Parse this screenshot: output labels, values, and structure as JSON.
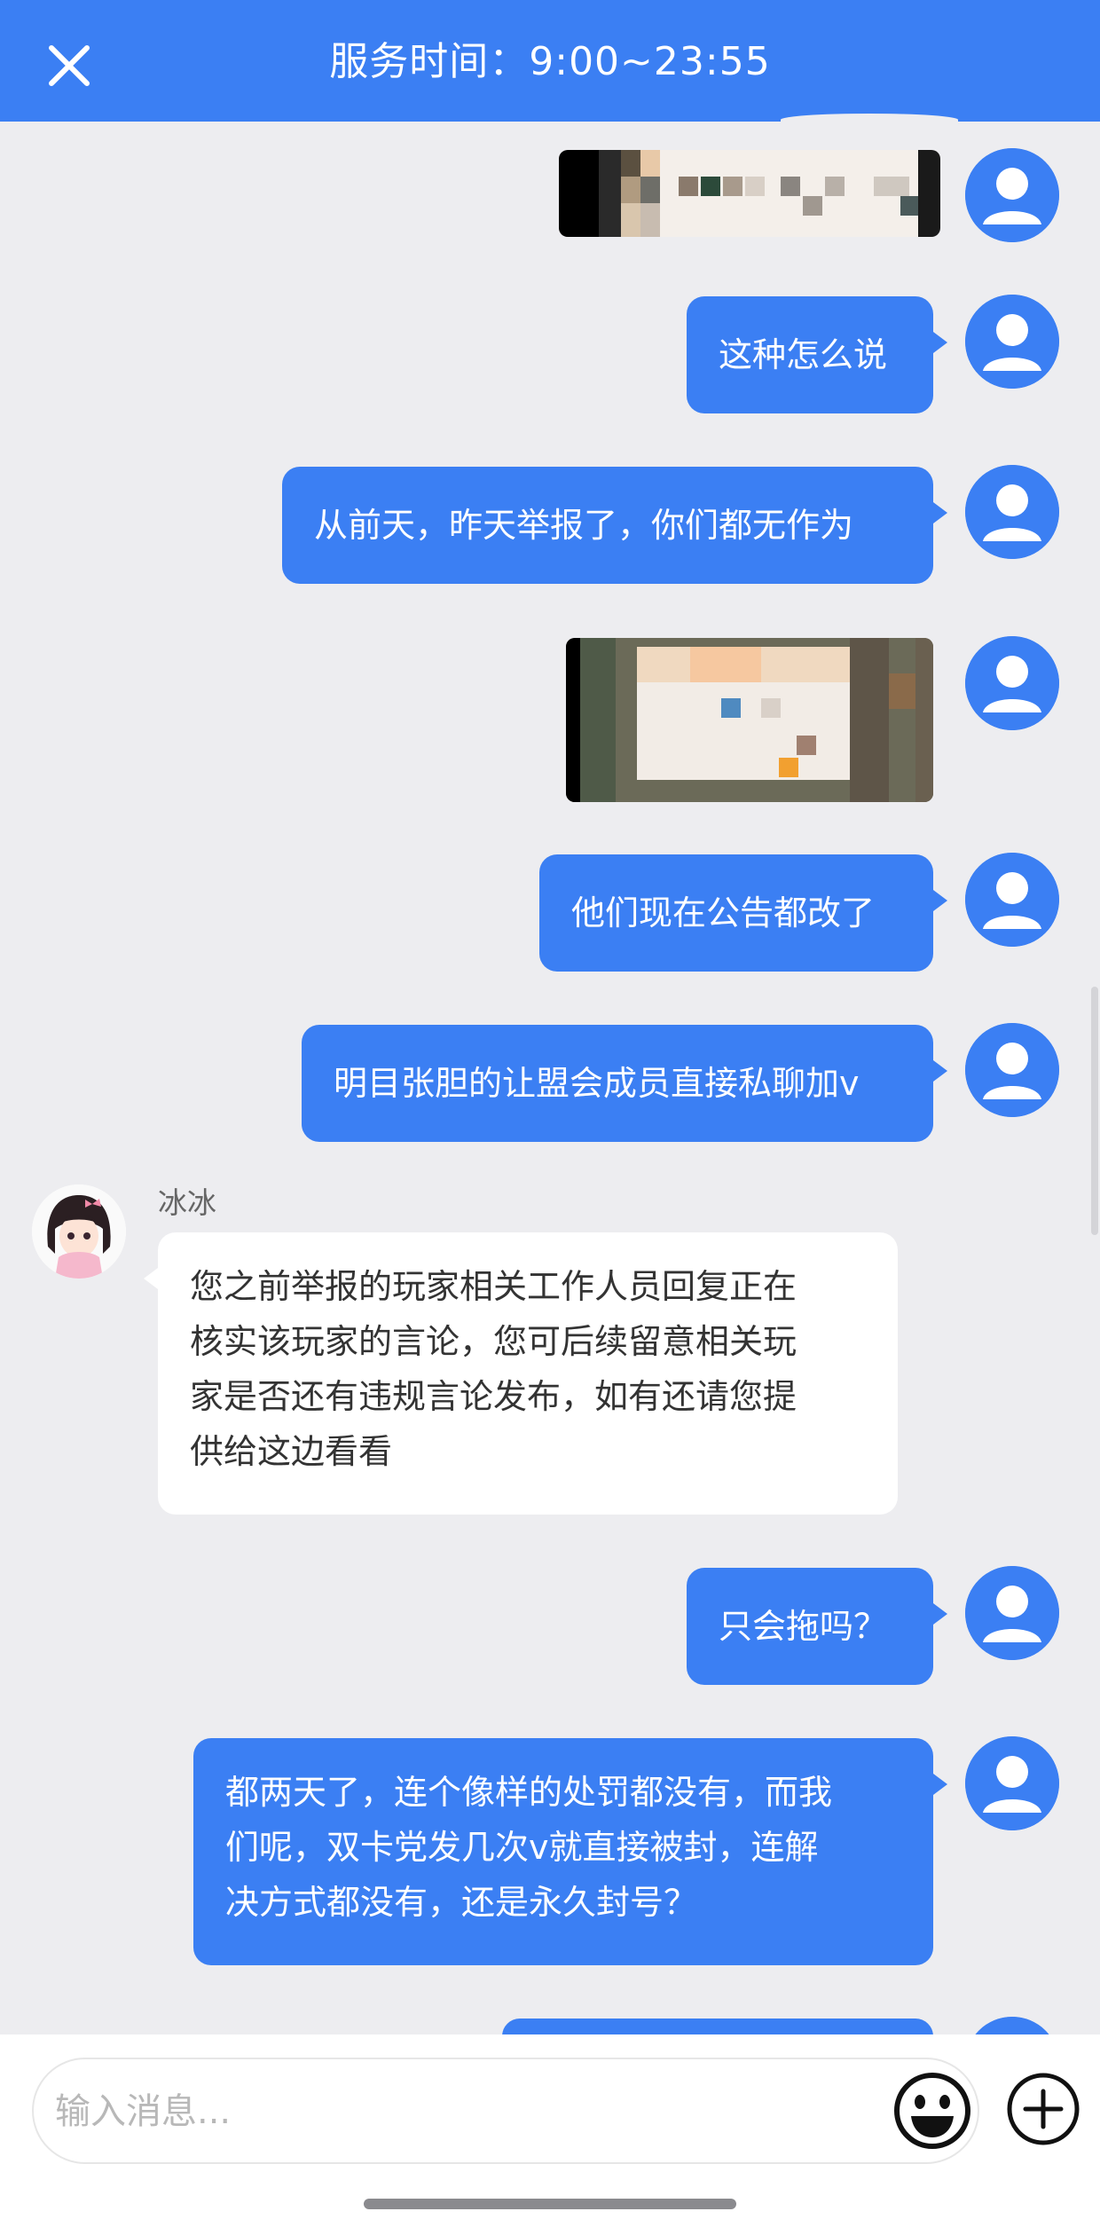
{
  "header": {
    "title": "服务时间：9:00~23:55"
  },
  "agent": {
    "name": "冰冰"
  },
  "messages": [
    {
      "from": "me",
      "type": "image"
    },
    {
      "from": "me",
      "type": "text",
      "text": "这种怎么说"
    },
    {
      "from": "me",
      "type": "text",
      "text": "从前天，昨天举报了，你们都无作为"
    },
    {
      "from": "me",
      "type": "image"
    },
    {
      "from": "me",
      "type": "text",
      "text": "他们现在公告都改了"
    },
    {
      "from": "me",
      "type": "text",
      "text": "明目张胆的让盟会成员直接私聊加v"
    },
    {
      "from": "agent",
      "type": "text",
      "lines": [
        "您之前举报的玩家相关工作人员回复正在",
        "核实该玩家的言论，您可后续留意相关玩",
        "家是否还有违规言论发布，如有还请您提",
        "供给这边看看"
      ]
    },
    {
      "from": "me",
      "type": "text",
      "text": "只会拖吗？"
    },
    {
      "from": "me",
      "type": "text",
      "lines": [
        "都两天了，连个像样的处罚都没有，而我",
        "们呢，双卡党发几次v就直接被封，连解",
        "决方式都没有，还是永久封号？"
      ]
    }
  ],
  "input": {
    "placeholder": "输入消息..."
  },
  "icons": {
    "close": "close-icon",
    "emoji": "emoji-icon",
    "plus": "plus-icon",
    "avatar": "user-avatar-icon"
  },
  "colors": {
    "accent": "#3b7ff3",
    "background": "#ededf0"
  }
}
